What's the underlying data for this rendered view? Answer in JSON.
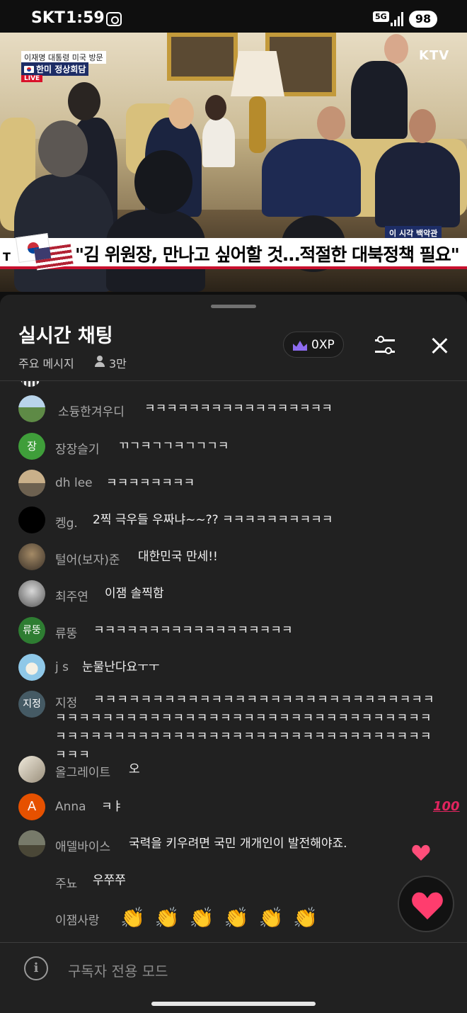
{
  "status_bar": {
    "carrier": "SKT",
    "time": "1:59",
    "network": "5G",
    "battery": "98"
  },
  "video": {
    "topic_badge": "이재명 대통령 미국 방문",
    "summit_badge": "한미 정상회담",
    "live_label": "LIVE",
    "broadcaster": "KTV",
    "location_label": "이 시각 백악관",
    "headline_left": "T",
    "headline": "\"김 위원장, 만나고 싶어할 것…적절한 대북정책 필요\""
  },
  "chat": {
    "title": "실시간 채팅",
    "subtitle": "주요 메시지",
    "viewer_count": "3만",
    "xp": "0XP",
    "input_placeholder": "구독자 전용 모드",
    "messages": [
      {
        "author": "소듕한겨우디",
        "text": "ㅋㅋㅋㅋㅋㅋㅋㅋㅋㅋㅋㅋㅋㅋㅋㅋㅋ",
        "avatar_text": "",
        "avatar_color": "#5d7b4a"
      },
      {
        "author": "장장슬기",
        "text": "ㄲㄱㅋㄱㄱㅋㄱㄱㄱㅋ",
        "avatar_text": "장",
        "avatar_color": "#3f9e3a"
      },
      {
        "author": "dh lee",
        "text": "ㅋㅋㅋㅋㅋㅋㅋㅋ",
        "avatar_text": "",
        "avatar_color": "#a8926a"
      },
      {
        "author": "켕g.",
        "text": "2찍 극우들 우짜냐~~?? ㅋㅋㅋㅋㅋㅋㅋㅋㅋㅋ",
        "avatar_text": "",
        "avatar_color": "#000000"
      },
      {
        "author": "털어(보자)준",
        "text": "대한민국 만세!!",
        "avatar_text": "",
        "avatar_color": "#6a5a45"
      },
      {
        "author": "최주연",
        "text": "이잼 솔찍함",
        "avatar_text": "",
        "avatar_color": "#8a8a8a"
      },
      {
        "author": "류뚱",
        "text": "ㅋㅋㅋㅋㅋㅋㅋㅋㅋㅋㅋㅋㅋㅋㅋㅋㅋㅋ",
        "avatar_text": "류뚱",
        "avatar_color": "#2e7d32"
      },
      {
        "author": "j s",
        "text": "눈물난다요ㅜㅜ",
        "avatar_text": "",
        "avatar_color": "#8fc8e8"
      },
      {
        "author": "지정",
        "text": "ㅋㅋㅋㅋㅋㅋㅋㅋㅋㅋㅋㅋㅋㅋㅋㅋㅋㅋㅋㅋㅋㅋㅋㅋㅋㅋㅋㅋㅋㅋㅋㅋㅋㅋㅋㅋㅋㅋㅋㅋㅋㅋㅋㅋㅋㅋㅋㅋㅋㅋㅋㅋㅋㅋㅋㅋㅋㅋㅋㅋㅋㅋㅋㅋㅋㅋㅋㅋㅋㅋㅋㅋㅋㅋㅋㅋㅋㅋㅋㅋㅋㅋㅋㅋㅋㅋㅋㅋㅋㅋㅋㅋㅋㅋㅋㅋ",
        "avatar_text": "지정",
        "avatar_color": "#455a64"
      },
      {
        "author": "올그레이트",
        "text": "오",
        "avatar_text": "",
        "avatar_color": "#d9d2c5"
      },
      {
        "author": "Anna",
        "text": "ㅋㅑ",
        "avatar_text": "A",
        "avatar_color": "#e65100",
        "badge_icon": "hundred-points-icon"
      },
      {
        "author": "애델바이스",
        "text": "국력을 키우려면 국민 개개인이 발전해야죠.",
        "avatar_text": "",
        "avatar_color": "#6b6a55"
      },
      {
        "author": "주뇨",
        "text": "우쭈쭈",
        "avatar_text": "",
        "avatar_color": ""
      },
      {
        "author": "이잼사랑",
        "text": "👏👏👏👏👏👏",
        "avatar_text": "",
        "avatar_color": ""
      }
    ]
  },
  "icons": {
    "crown": "crown-icon",
    "filter": "filter-settings-icon",
    "close": "close-icon",
    "viewers": "person-icon",
    "info": "info-icon",
    "reaction": "heart-icon"
  }
}
